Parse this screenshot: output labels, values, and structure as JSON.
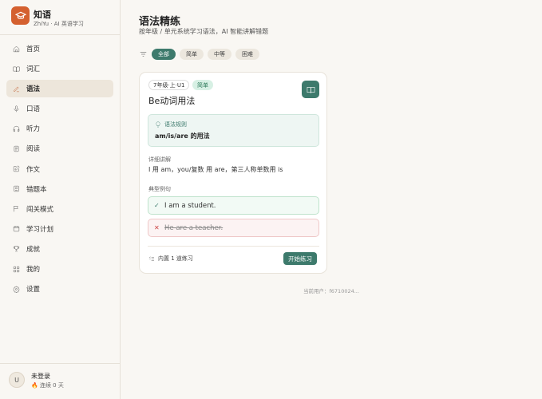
{
  "app": {
    "name": "知语",
    "subtitle": "ZhiYu · AI 英语学习",
    "accent": "#d4602f",
    "primary": "#3d7a6c"
  },
  "sidebar": {
    "items": [
      {
        "label": "首页",
        "icon": "home-icon"
      },
      {
        "label": "词汇",
        "icon": "book-open-icon"
      },
      {
        "label": "语法",
        "icon": "pen-icon",
        "active": true
      },
      {
        "label": "口语",
        "icon": "mic-icon"
      },
      {
        "label": "听力",
        "icon": "headphones-icon"
      },
      {
        "label": "阅读",
        "icon": "document-icon"
      },
      {
        "label": "作文",
        "icon": "edit-icon"
      },
      {
        "label": "错题本",
        "icon": "notebook-icon"
      },
      {
        "label": "闯关模式",
        "icon": "flag-icon"
      },
      {
        "label": "学习计划",
        "icon": "calendar-icon"
      },
      {
        "label": "成就",
        "icon": "trophy-icon"
      },
      {
        "label": "我的",
        "icon": "grid-icon"
      },
      {
        "label": "设置",
        "icon": "gear-icon"
      }
    ]
  },
  "user": {
    "avatar": "U",
    "name": "未登录",
    "streak": "连续 0 天"
  },
  "header": {
    "title": "语法精练",
    "subtitle": "按年级 / 单元系统学习语法，AI 智能讲解错题"
  },
  "filters": {
    "options": [
      "全部",
      "简单",
      "中等",
      "困难"
    ],
    "active": "全部"
  },
  "card": {
    "grade": "7年级·上·U1",
    "level": "简单",
    "title": "Be动词用法",
    "rule_label": "语法规则",
    "rule_text": "am/is/are 的用法",
    "detail_label": "详细讲解",
    "detail_text": "I 用 am，you/复数 用 are，第三人称单数用 is",
    "examples_label": "典型例句",
    "good_example": "I am a student.",
    "bad_example": "He are a teacher.",
    "exercise_count": "内置 1 道练习",
    "start_label": "开始练习"
  },
  "footer": {
    "current_user": "当前用户：f6710024..."
  }
}
